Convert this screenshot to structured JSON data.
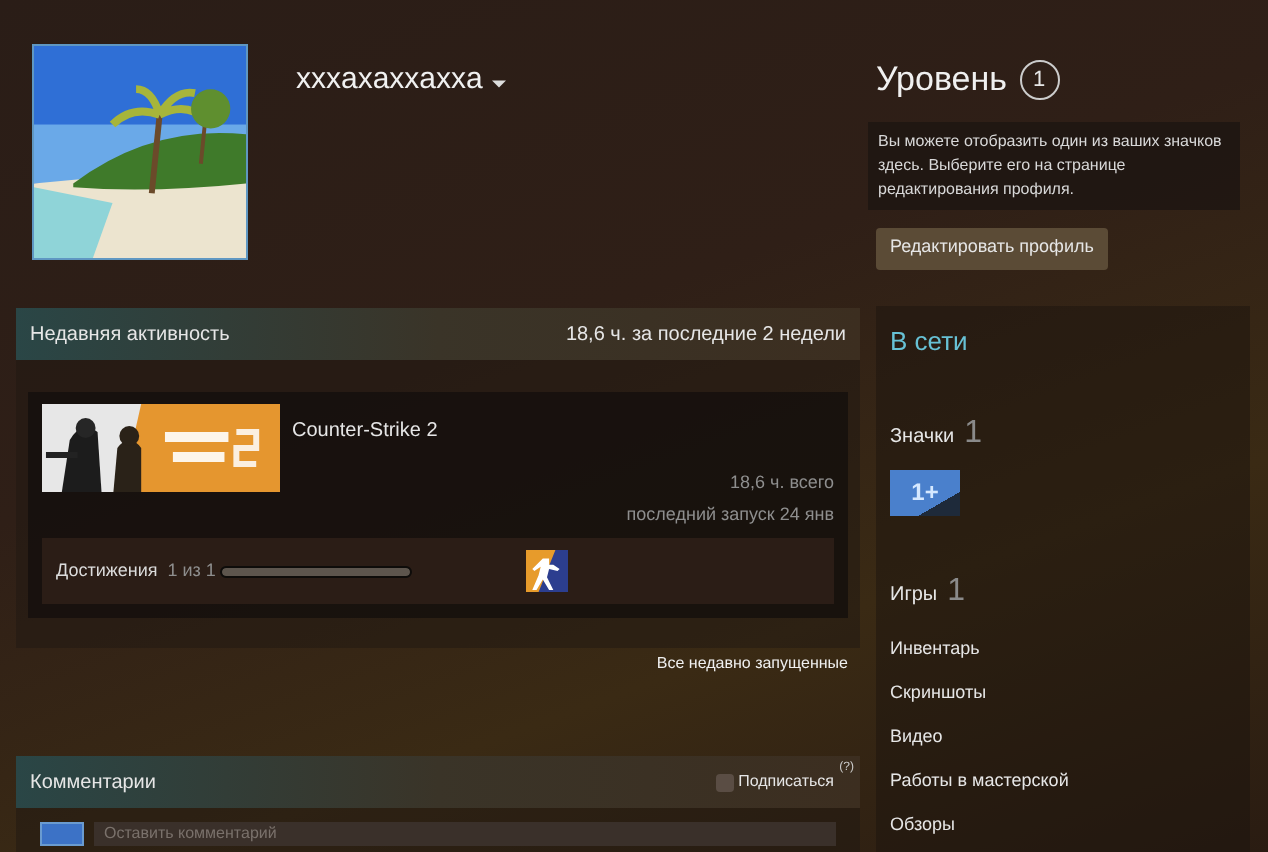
{
  "profile": {
    "name": "xxxaxaxxaxxa",
    "level_label": "Уровень",
    "level": "1",
    "badge_hint": "Вы можете отобразить один из ваших значков здесь. Выберите его на странице редактирования профиля.",
    "edit_button": "Редактировать профиль"
  },
  "recent_activity": {
    "title": "Недавняя активность",
    "summary": "18,6 ч. за последние 2 недели",
    "games": [
      {
        "name": "Counter-Strike 2",
        "hours": "18,6 ч. всего",
        "last_played": "последний запуск 24 янв",
        "achievements_label": "Достижения",
        "achievements_count": "1 из 1",
        "level": 1
      }
    ],
    "all_link": "Все недавно запущенные"
  },
  "comments": {
    "title": "Комментарии",
    "subscribe": {
      "label": "Подписаться",
      "checked": false
    },
    "help": "(?)",
    "placeholder": "Оставить комментарий"
  },
  "sidebar": {
    "status": "В сети",
    "sections": [
      {
        "kind": "count",
        "label": "Значки",
        "count": "1"
      },
      {
        "kind": "badge",
        "text": "1+"
      },
      {
        "kind": "count",
        "label": "Игры",
        "count": "1"
      },
      {
        "kind": "link",
        "label": "Инвентарь"
      },
      {
        "kind": "link",
        "label": "Скриншоты"
      },
      {
        "kind": "link",
        "label": "Видео"
      },
      {
        "kind": "link",
        "label": "Работы в мастерской"
      },
      {
        "kind": "link",
        "label": "Обзоры"
      }
    ]
  }
}
